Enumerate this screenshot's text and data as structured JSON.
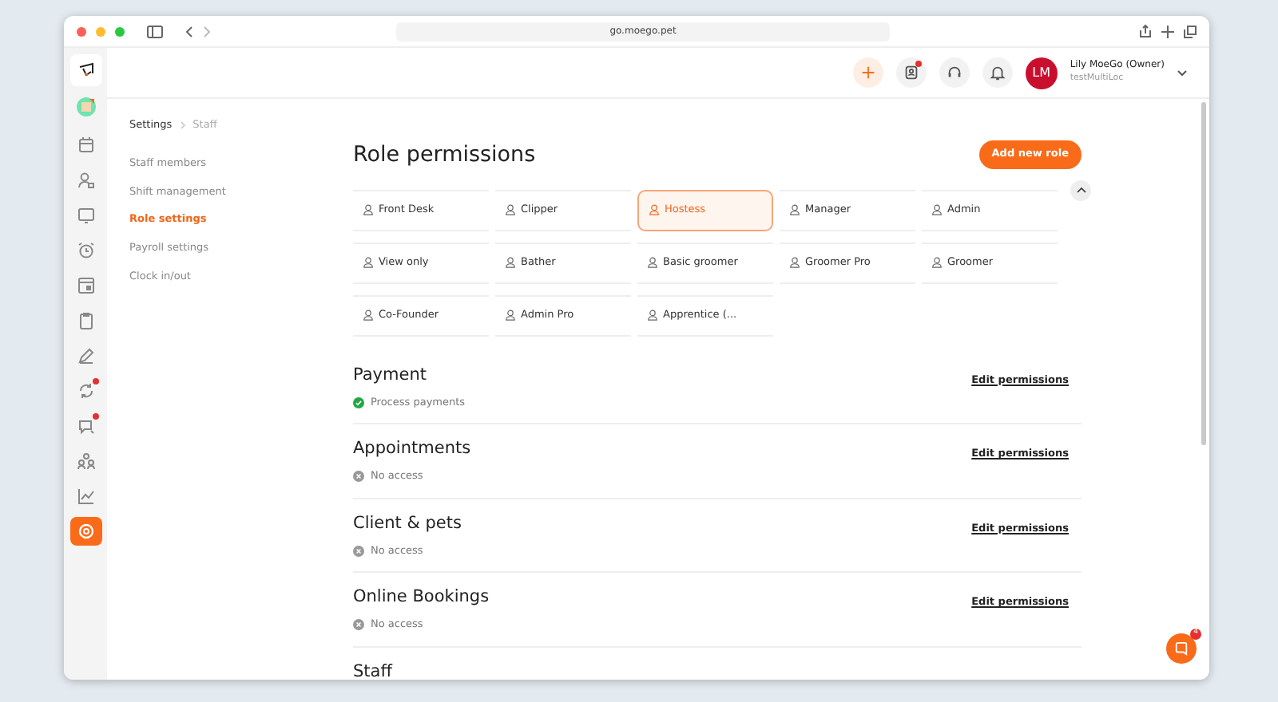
{
  "browser": {
    "url": "go.moego.pet"
  },
  "header": {
    "user_name": "Lily MoeGo (Owner)",
    "business": "testMultiLoc",
    "initials": "LM",
    "actions": [
      {
        "badge": false
      },
      {
        "badge": true
      },
      {
        "badge": false
      },
      {
        "badge": false
      }
    ]
  },
  "rail": [
    {
      "selected": false,
      "badge": false
    },
    {
      "selected": false,
      "badge": false
    },
    {
      "selected": false,
      "badge": false
    },
    {
      "selected": false,
      "badge": false
    },
    {
      "selected": false,
      "badge": false
    },
    {
      "selected": false,
      "badge": false
    },
    {
      "selected": false,
      "badge": false
    },
    {
      "selected": false,
      "badge": false
    },
    {
      "selected": false,
      "badge": false
    },
    {
      "selected": false,
      "badge": true
    },
    {
      "selected": false,
      "badge": true
    },
    {
      "selected": false,
      "badge": false
    },
    {
      "selected": false,
      "badge": false
    },
    {
      "selected": true,
      "badge": false
    }
  ],
  "breadcrumb": [
    "Settings",
    "Staff"
  ],
  "settings_nav": [
    {
      "label": "Staff members",
      "selected": false
    },
    {
      "label": "Shift management",
      "selected": false
    },
    {
      "label": "Role settings",
      "selected": true
    },
    {
      "label": "Payroll settings",
      "selected": false
    },
    {
      "label": "Clock in/out",
      "selected": false
    }
  ],
  "page_title": "Role permissions",
  "add_button": "Add new role",
  "roles": [
    {
      "label": "Front Desk",
      "selected": false
    },
    {
      "label": "Clipper",
      "selected": false
    },
    {
      "label": "Hostess",
      "selected": true
    },
    {
      "label": "Manager",
      "selected": false
    },
    {
      "label": "Admin",
      "selected": false
    },
    {
      "label": "View only",
      "selected": false
    },
    {
      "label": "Bather",
      "selected": false
    },
    {
      "label": "Basic groomer",
      "selected": false
    },
    {
      "label": "Groomer Pro",
      "selected": false
    },
    {
      "label": "Groomer",
      "selected": false
    },
    {
      "label": "Co-Founder",
      "selected": false
    },
    {
      "label": "Admin Pro",
      "selected": false
    },
    {
      "label": "Apprentice (...",
      "selected": false
    }
  ],
  "roles_expanded": true,
  "sections": [
    {
      "title": "Payment",
      "kind": "granted",
      "summary": "Process payments",
      "link": "Edit permissions"
    },
    {
      "title": "Appointments",
      "kind": "denied",
      "summary": "No access",
      "link": "Edit permissions"
    },
    {
      "title": "Client & pets",
      "kind": "denied",
      "summary": "No access",
      "link": "Edit permissions"
    },
    {
      "title": "Online Bookings",
      "kind": "denied",
      "summary": "No access",
      "link": "Edit permissions"
    },
    {
      "title": "Staff",
      "kind": "heading"
    }
  ],
  "chat": {
    "badge": "4"
  }
}
